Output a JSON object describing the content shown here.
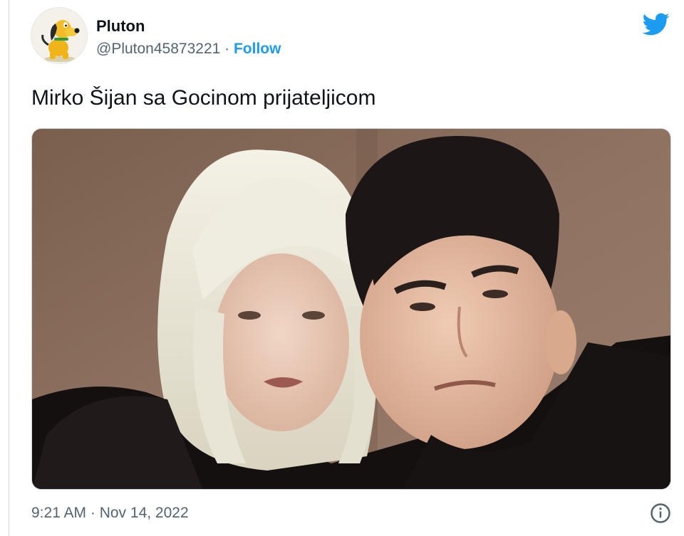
{
  "user": {
    "display_name": "Pluton",
    "handle": "@Pluton45873221",
    "separator": "·",
    "follow_label": "Follow"
  },
  "tweet": {
    "text": "Mirko Šijan sa Gocinom prijateljicom",
    "timestamp": "9:21 AM · Nov 14, 2022"
  },
  "icons": {
    "brand": "twitter-bird-icon",
    "info": "info-icon",
    "avatar": "pluto-cartoon-avatar"
  },
  "colors": {
    "brand_blue": "#1d9bf0",
    "text_primary": "#0f1419",
    "text_secondary": "#536471"
  }
}
